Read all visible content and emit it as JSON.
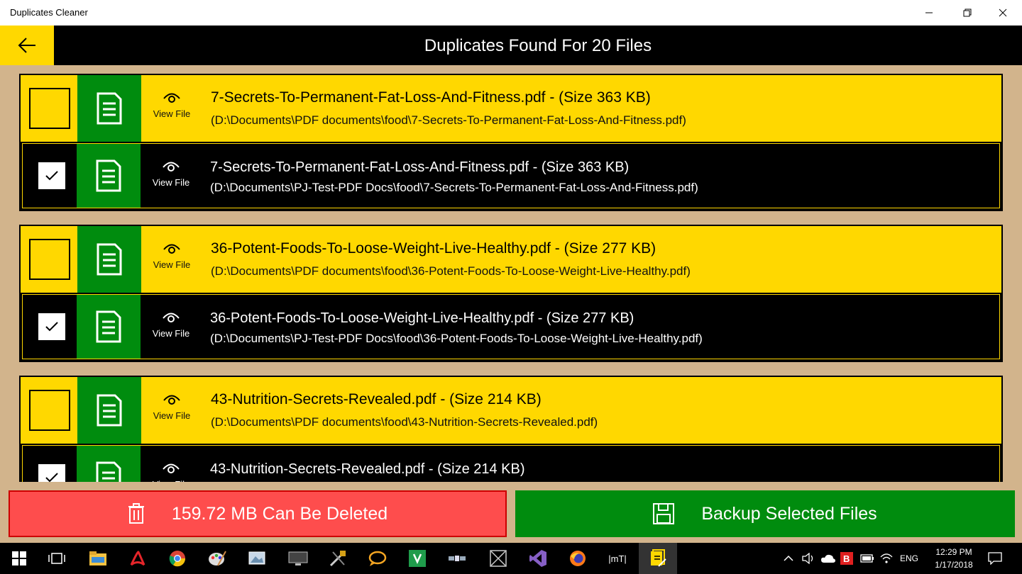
{
  "window": {
    "title": "Duplicates Cleaner"
  },
  "header": {
    "title": "Duplicates Found For 20 Files"
  },
  "view_label": "View File",
  "groups": [
    {
      "original": {
        "name": "7-Secrets-To-Permanent-Fat-Loss-And-Fitness.pdf - (Size 363 KB)",
        "path": "(D:\\Documents\\PDF documents\\food\\7-Secrets-To-Permanent-Fat-Loss-And-Fitness.pdf)",
        "checked": false
      },
      "duplicate": {
        "name": "7-Secrets-To-Permanent-Fat-Loss-And-Fitness.pdf - (Size 363 KB)",
        "path": "(D:\\Documents\\PJ-Test-PDF Docs\\food\\7-Secrets-To-Permanent-Fat-Loss-And-Fitness.pdf)",
        "checked": true
      }
    },
    {
      "original": {
        "name": "36-Potent-Foods-To-Loose-Weight-Live-Healthy.pdf - (Size 277 KB)",
        "path": "(D:\\Documents\\PDF documents\\food\\36-Potent-Foods-To-Loose-Weight-Live-Healthy.pdf)",
        "checked": false
      },
      "duplicate": {
        "name": "36-Potent-Foods-To-Loose-Weight-Live-Healthy.pdf - (Size 277 KB)",
        "path": "(D:\\Documents\\PJ-Test-PDF Docs\\food\\36-Potent-Foods-To-Loose-Weight-Live-Healthy.pdf)",
        "checked": true
      }
    },
    {
      "original": {
        "name": "43-Nutrition-Secrets-Revealed.pdf - (Size 214 KB)",
        "path": "(D:\\Documents\\PDF documents\\food\\43-Nutrition-Secrets-Revealed.pdf)",
        "checked": false
      },
      "duplicate": {
        "name": "43-Nutrition-Secrets-Revealed.pdf - (Size 214 KB)",
        "path": "",
        "checked": true
      }
    }
  ],
  "actions": {
    "delete_label": "159.72 MB Can Be Deleted",
    "backup_label": "Backup Selected Files"
  },
  "taskbar": {
    "language": "ENG",
    "time": "12:29 PM",
    "date": "1/17/2018",
    "mt_label": "|mT|"
  },
  "colors": {
    "yellow": "#ffd800",
    "green": "#008c0e",
    "red": "#fe4d4d",
    "tan": "#d2b48c"
  }
}
